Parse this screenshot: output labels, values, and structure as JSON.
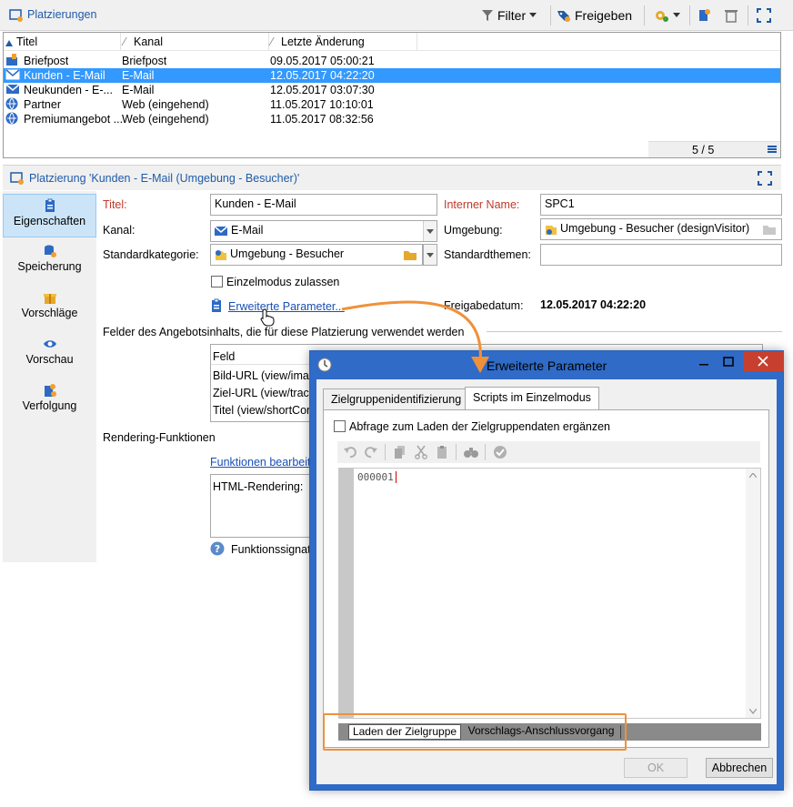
{
  "toolbar": {
    "title": "Platzierungen",
    "filter_label": "Filter",
    "freigeben_label": "Freigeben"
  },
  "list": {
    "columns": [
      "Titel",
      "Kanal",
      "Letzte Änderung"
    ],
    "rows": [
      {
        "title": "Briefpost",
        "channel": "Briefpost",
        "modified": "09.05.2017 05:00:21",
        "icon": "letter-icon"
      },
      {
        "title": "Kunden - E-Mail",
        "channel": "E-Mail",
        "modified": "12.05.2017 04:22:20",
        "icon": "email-icon",
        "selected": true
      },
      {
        "title": "Neukunden - E-...",
        "channel": "E-Mail",
        "modified": "12.05.2017 03:07:30",
        "icon": "email-icon"
      },
      {
        "title": "Partner",
        "channel": "Web (eingehend)",
        "modified": "11.05.2017 10:10:01",
        "icon": "globe-icon"
      },
      {
        "title": "Premiumangebot ...",
        "channel": "Web (eingehend)",
        "modified": "11.05.2017 08:32:56",
        "icon": "globe-icon"
      }
    ],
    "count": "5 / 5"
  },
  "detail": {
    "header": "Platzierung 'Kunden - E-Mail (Umgebung - Besucher)'",
    "nav": [
      {
        "label": "Eigenschaften",
        "icon": "clipboard-icon",
        "active": true
      },
      {
        "label": "Speicherung",
        "icon": "database-icon"
      },
      {
        "label": "Vorschläge",
        "icon": "gift-icon"
      },
      {
        "label": "Vorschau",
        "icon": "eye-icon"
      },
      {
        "label": "Verfolgung",
        "icon": "tracking-icon"
      }
    ],
    "labels": {
      "title": "Titel:",
      "channel": "Kanal:",
      "category": "Standardkategorie:",
      "internal_name": "Interner Name:",
      "environment": "Umgebung:",
      "themes": "Standardthemen:",
      "single_mode": "Einzelmodus zulassen",
      "advanced_params": "Erweiterte Parameter...",
      "release_date": "Freigabedatum:",
      "fields_section": "Felder des Angebotsinhalts, die für diese Platzierung verwendet werden",
      "rendering_section": "Rendering-Funktionen",
      "edit_functions": "Funktionen bearbeiten...",
      "html_rendering": "HTML-Rendering:",
      "function_signature": "Funktionssignatur"
    },
    "values": {
      "title": "Kunden - E-Mail",
      "channel": "E-Mail",
      "category": "Umgebung - Besucher",
      "internal_name": "SPC1",
      "environment": "Umgebung - Besucher (designVisitor)",
      "themes": "",
      "release_date": "12.05.2017 04:22:20"
    },
    "fields_table": {
      "header": "Feld",
      "rows": [
        "Bild-URL (view/image)",
        "Ziel-URL (view/trackingUrl)",
        "Titel (view/shortContent)"
      ]
    }
  },
  "dialog": {
    "title": "Erweiterte Parameter",
    "tabs": [
      "Zielgruppenidentifizierung",
      "Scripts im Einzelmodus"
    ],
    "active_tab": 1,
    "checkbox_label": "Abfrage zum Laden der Zielgruppendaten ergänzen",
    "editor_line": "000001",
    "bottom_tabs": [
      "Laden der Zielgruppe",
      "Vorschlags-Anschlussvorgang"
    ],
    "ok_label": "OK",
    "cancel_label": "Abbrechen"
  },
  "colors": {
    "accent": "#2f6bc7",
    "selection": "#3399ff",
    "required_label": "#c0392b",
    "highlight_orange": "#f0913a",
    "link": "#1a4fb5"
  }
}
